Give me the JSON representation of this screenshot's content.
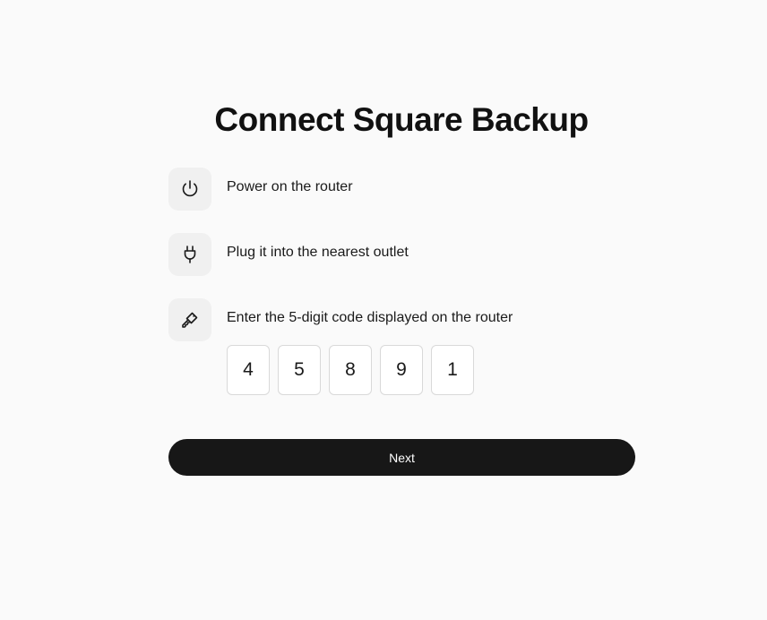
{
  "page": {
    "title": "Connect Square Backup"
  },
  "steps": [
    {
      "icon": "power-icon",
      "label": "Power on the router"
    },
    {
      "icon": "plug-icon",
      "label": "Plug it into the nearest outlet"
    },
    {
      "icon": "key-icon",
      "label": "Enter the 5-digit code displayed on the router"
    }
  ],
  "code": {
    "digits": [
      "4",
      "5",
      "8",
      "9",
      "1"
    ]
  },
  "actions": {
    "next_label": "Next"
  }
}
